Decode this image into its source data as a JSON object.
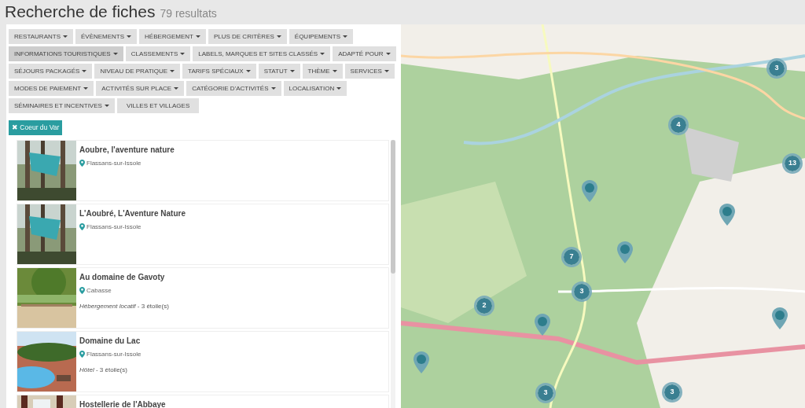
{
  "header": {
    "title": "Recherche de fiches",
    "count": "79 resultats"
  },
  "filters": [
    {
      "label": "RESTAURANTS",
      "menu": true,
      "active": false
    },
    {
      "label": "ÉVÈNEMENTS",
      "menu": true,
      "active": false
    },
    {
      "label": "HÉBERGEMENT",
      "menu": true,
      "active": false
    },
    {
      "label": "PLUS DE CRITÈRES",
      "menu": true,
      "active": false
    },
    {
      "label": "ÉQUIPEMENTS",
      "menu": true,
      "active": false
    },
    {
      "label": "INFORMATIONS TOURISTIQUES",
      "menu": true,
      "active": true
    },
    {
      "label": "CLASSEMENTS",
      "menu": true,
      "active": false
    },
    {
      "label": "LABELS, MARQUES ET SITES CLASSÉS",
      "menu": true,
      "active": false
    },
    {
      "label": "ADAPTÉ POUR",
      "menu": true,
      "active": false
    },
    {
      "label": "SÉJOURS PACKAGÉS",
      "menu": true,
      "active": false
    },
    {
      "label": "NIVEAU DE PRATIQUE",
      "menu": true,
      "active": false
    },
    {
      "label": "TARIFS SPÉCIAUX",
      "menu": true,
      "active": false
    },
    {
      "label": "STATUT",
      "menu": true,
      "active": false
    },
    {
      "label": "THÈME",
      "menu": true,
      "active": false
    },
    {
      "label": "SERVICES",
      "menu": true,
      "active": false
    },
    {
      "label": "MODES DE PAIEMENT",
      "menu": true,
      "active": false
    },
    {
      "label": "ACTIVITÉS SUR PLACE",
      "menu": true,
      "active": false
    },
    {
      "label": "CATÉGORIE D'ACTIVITÉS",
      "menu": true,
      "active": false
    },
    {
      "label": "LOCALISATION",
      "menu": true,
      "active": false
    },
    {
      "label": "SÉMINAIRES ET INCENTIVES",
      "menu": true,
      "active": false
    },
    {
      "label": "VILLES ET VILLAGES",
      "menu": false,
      "active": false
    }
  ],
  "tags": [
    {
      "label": "Coeur du Var",
      "remove": "✖"
    }
  ],
  "results": [
    {
      "title": "Aoubre, l'aventure nature",
      "place": "Flassans-sur-Issole",
      "kind": "picture"
    },
    {
      "title": "L'Aoubré, L'Aventure Nature",
      "place": "Flassans-sur-Issole",
      "kind": "picture"
    },
    {
      "title": "Au domaine de Gavoty",
      "place": "Cabasse",
      "details": "*Hébergement locatif* - 3 étoile(s)",
      "kind": "picture"
    },
    {
      "title": "Domaine du Lac",
      "place": "Flassans-sur-Issole",
      "details": "*Hôtel* - 3 étoile(s)",
      "kind": "picture"
    },
    {
      "title": "Hostellerie de l'Abbaye",
      "kind": "picture"
    }
  ],
  "map": {
    "kind": "picture",
    "markers": [
      {
        "kind": "cluster",
        "count": "3"
      },
      {
        "kind": "cluster",
        "count": "4"
      },
      {
        "kind": "cluster",
        "count": "13"
      },
      {
        "kind": "pin"
      },
      {
        "kind": "pin"
      },
      {
        "kind": "cluster",
        "count": "7"
      },
      {
        "kind": "pin"
      },
      {
        "kind": "cluster",
        "count": "3"
      },
      {
        "kind": "cluster",
        "count": "2"
      },
      {
        "kind": "pin"
      },
      {
        "kind": "pin"
      },
      {
        "kind": "pin"
      },
      {
        "kind": "cluster",
        "count": "3"
      },
      {
        "kind": "cluster",
        "count": "3"
      }
    ]
  }
}
